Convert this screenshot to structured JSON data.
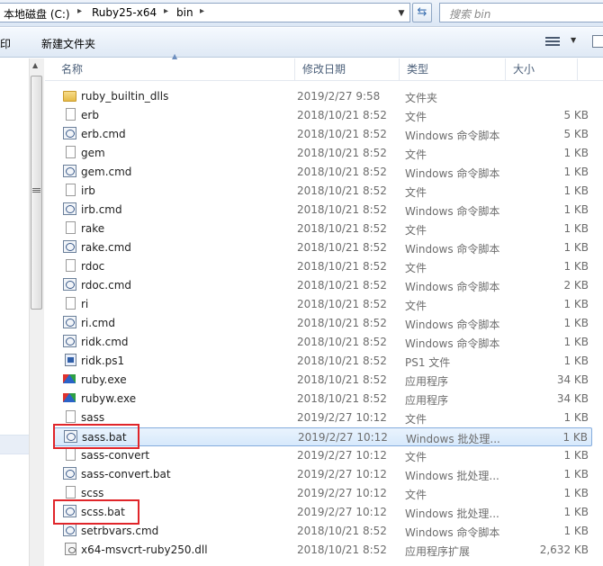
{
  "address": {
    "segments": [
      "本地磁盘 (C:)",
      "Ruby25-x64",
      "bin"
    ],
    "search_placeholder": "搜索 bin"
  },
  "toolbar": {
    "print_partial": "打印",
    "new_folder": "新建文件夹"
  },
  "columns": {
    "name": "名称",
    "date": "修改日期",
    "type": "类型",
    "size": "大小"
  },
  "files": [
    {
      "name": "ruby_builtin_dlls",
      "date": "2019/2/27 9:58",
      "type": "文件夹",
      "size": "",
      "icon": "folder-icon"
    },
    {
      "name": "erb",
      "date": "2018/10/21 8:52",
      "type": "文件",
      "size": "5 KB",
      "icon": "file-icon"
    },
    {
      "name": "erb.cmd",
      "date": "2018/10/21 8:52",
      "type": "Windows 命令脚本",
      "size": "5 KB",
      "icon": "cmd-script-icon"
    },
    {
      "name": "gem",
      "date": "2018/10/21 8:52",
      "type": "文件",
      "size": "1 KB",
      "icon": "file-icon"
    },
    {
      "name": "gem.cmd",
      "date": "2018/10/21 8:52",
      "type": "Windows 命令脚本",
      "size": "1 KB",
      "icon": "cmd-script-icon"
    },
    {
      "name": "irb",
      "date": "2018/10/21 8:52",
      "type": "文件",
      "size": "1 KB",
      "icon": "file-icon"
    },
    {
      "name": "irb.cmd",
      "date": "2018/10/21 8:52",
      "type": "Windows 命令脚本",
      "size": "1 KB",
      "icon": "cmd-script-icon"
    },
    {
      "name": "rake",
      "date": "2018/10/21 8:52",
      "type": "文件",
      "size": "1 KB",
      "icon": "file-icon"
    },
    {
      "name": "rake.cmd",
      "date": "2018/10/21 8:52",
      "type": "Windows 命令脚本",
      "size": "1 KB",
      "icon": "cmd-script-icon"
    },
    {
      "name": "rdoc",
      "date": "2018/10/21 8:52",
      "type": "文件",
      "size": "1 KB",
      "icon": "file-icon"
    },
    {
      "name": "rdoc.cmd",
      "date": "2018/10/21 8:52",
      "type": "Windows 命令脚本",
      "size": "2 KB",
      "icon": "cmd-script-icon"
    },
    {
      "name": "ri",
      "date": "2018/10/21 8:52",
      "type": "文件",
      "size": "1 KB",
      "icon": "file-icon"
    },
    {
      "name": "ri.cmd",
      "date": "2018/10/21 8:52",
      "type": "Windows 命令脚本",
      "size": "1 KB",
      "icon": "cmd-script-icon"
    },
    {
      "name": "ridk.cmd",
      "date": "2018/10/21 8:52",
      "type": "Windows 命令脚本",
      "size": "1 KB",
      "icon": "cmd-script-icon"
    },
    {
      "name": "ridk.ps1",
      "date": "2018/10/21 8:52",
      "type": "PS1 文件",
      "size": "1 KB",
      "icon": "powershell-script-icon"
    },
    {
      "name": "ruby.exe",
      "date": "2018/10/21 8:52",
      "type": "应用程序",
      "size": "34 KB",
      "icon": "ruby-exe-icon"
    },
    {
      "name": "rubyw.exe",
      "date": "2018/10/21 8:52",
      "type": "应用程序",
      "size": "34 KB",
      "icon": "ruby-exe-icon"
    },
    {
      "name": "sass",
      "date": "2019/2/27 10:12",
      "type": "文件",
      "size": "1 KB",
      "icon": "file-icon"
    },
    {
      "name": "sass.bat",
      "date": "2019/2/27 10:12",
      "type": "Windows 批处理...",
      "size": "1 KB",
      "icon": "batch-file-icon",
      "selected": true
    },
    {
      "name": "sass-convert",
      "date": "2019/2/27 10:12",
      "type": "文件",
      "size": "1 KB",
      "icon": "file-icon"
    },
    {
      "name": "sass-convert.bat",
      "date": "2019/2/27 10:12",
      "type": "Windows 批处理...",
      "size": "1 KB",
      "icon": "batch-file-icon"
    },
    {
      "name": "scss",
      "date": "2019/2/27 10:12",
      "type": "文件",
      "size": "1 KB",
      "icon": "file-icon"
    },
    {
      "name": "scss.bat",
      "date": "2019/2/27 10:12",
      "type": "Windows 批处理...",
      "size": "1 KB",
      "icon": "batch-file-icon"
    },
    {
      "name": "setrbvars.cmd",
      "date": "2018/10/21 8:52",
      "type": "Windows 命令脚本",
      "size": "1 KB",
      "icon": "cmd-script-icon"
    },
    {
      "name": "x64-msvcrt-ruby250.dll",
      "date": "2018/10/21 8:52",
      "type": "应用程序扩展",
      "size": "2,632 KB",
      "icon": "dll-icon"
    }
  ],
  "annotations": {
    "highlighted_files": [
      "sass.bat",
      "scss.bat"
    ],
    "highlight_color": "#e0252a"
  },
  "colors": {
    "selection_border": "#84acdd",
    "header_text": "#4c607a"
  }
}
